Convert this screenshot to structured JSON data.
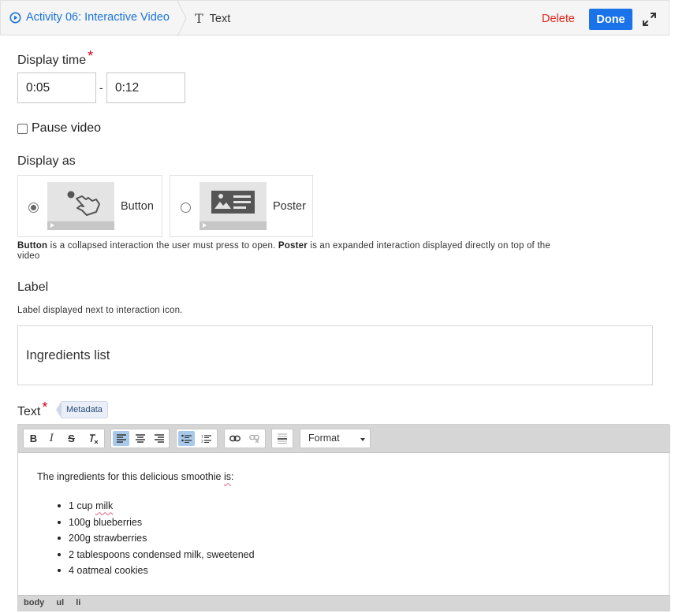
{
  "header": {
    "activity_title": "Activity 06: Interactive Video",
    "current_item": "Text",
    "delete_label": "Delete",
    "done_label": "Done"
  },
  "form": {
    "display_time": {
      "label": "Display time",
      "required_mark": "*",
      "start": "0:05",
      "separator": "-",
      "end": "0:12"
    },
    "pause_video": {
      "label": "Pause video",
      "checked": false
    },
    "display_as": {
      "label": "Display as",
      "options": [
        {
          "label": "Button",
          "selected": true
        },
        {
          "label": "Poster",
          "selected": false
        }
      ],
      "description": {
        "button_term": "Button",
        "button_text": " is a collapsed interaction the user must press to open. ",
        "poster_term": "Poster",
        "poster_text": " is an expanded interaction displayed directly on top of the",
        "poster_text_2": "video"
      }
    },
    "label": {
      "title": "Label",
      "hint": "Label displayed next to interaction icon.",
      "value": "Ingredients list"
    },
    "text": {
      "title": "Text",
      "required_mark": "*",
      "metadata_label": "Metadata",
      "format_label": "Format",
      "intro_before": "The ingredients for this delicious smoothie ",
      "intro_squiggle": "is",
      "intro_after": ":",
      "items": [
        {
          "before": "1 cup ",
          "squiggle": "milk"
        },
        {
          "before": "100g blueberries",
          "squiggle": ""
        },
        {
          "before": "200g strawberries",
          "squiggle": ""
        },
        {
          "before": "2 tablespoons condensed milk, sweetened",
          "squiggle": ""
        },
        {
          "before": "4 oatmeal cookies",
          "squiggle": ""
        }
      ],
      "path": [
        "body",
        "ul",
        "li"
      ]
    }
  },
  "colors": {
    "accent": "#1a73e8",
    "delete": "#e3261b",
    "required": "#d0021b"
  }
}
